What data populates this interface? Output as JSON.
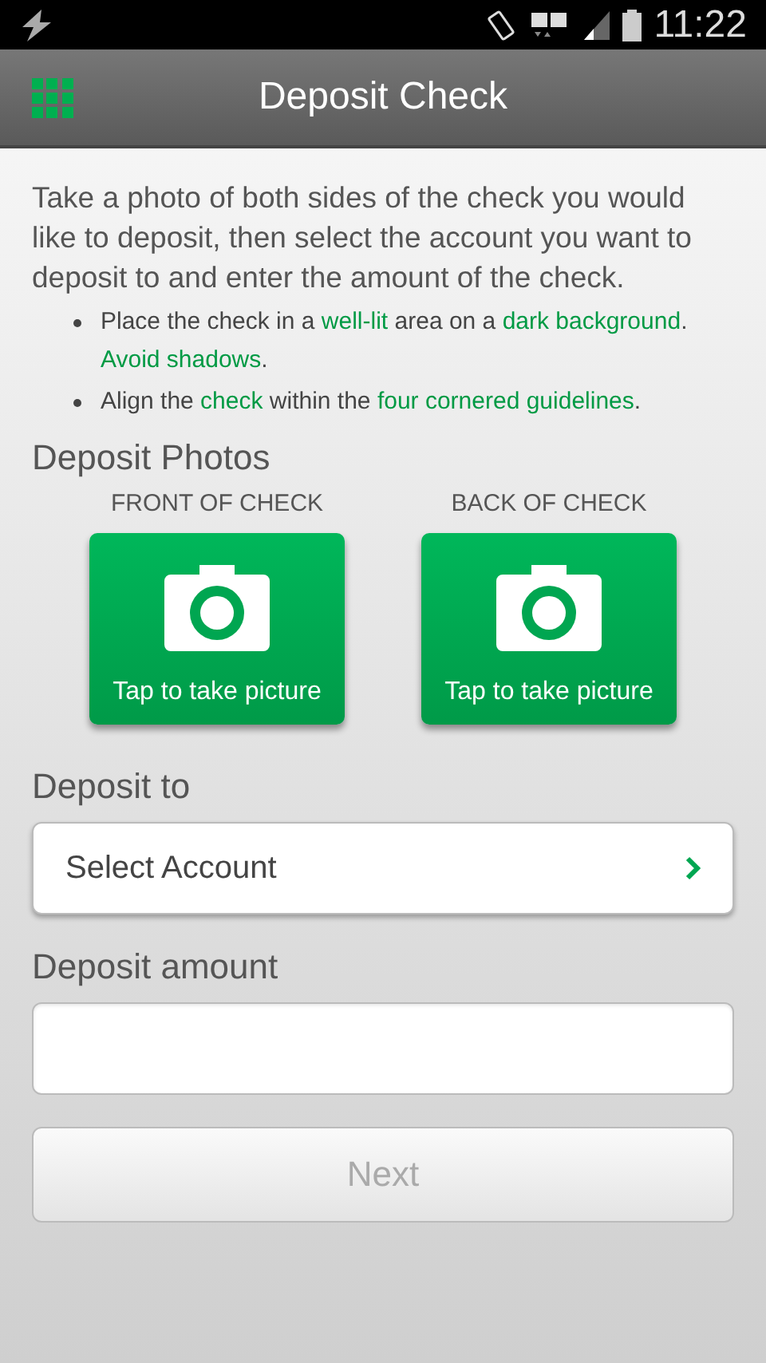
{
  "status_bar": {
    "time": "11:22"
  },
  "app_bar": {
    "title": "Deposit Check"
  },
  "intro": "Take a photo of both sides of the check you would like to deposit, then select the account you want to deposit to and enter the amount of the check.",
  "tips": [
    [
      {
        "text": "Place the check in a ",
        "highlight": false
      },
      {
        "text": "well-lit",
        "highlight": true
      },
      {
        "text": " area on a ",
        "highlight": false
      },
      {
        "text": "dark background",
        "highlight": true
      },
      {
        "text": ". ",
        "highlight": false
      },
      {
        "text": "Avoid shadows",
        "highlight": true
      },
      {
        "text": ".",
        "highlight": false
      }
    ],
    [
      {
        "text": "Align the ",
        "highlight": false
      },
      {
        "text": "check",
        "highlight": true
      },
      {
        "text": " within the ",
        "highlight": false
      },
      {
        "text": "four cornered guidelines",
        "highlight": true
      },
      {
        "text": ".",
        "highlight": false
      }
    ]
  ],
  "photos": {
    "heading": "Deposit Photos",
    "items": [
      {
        "caption": "FRONT OF CHECK",
        "button": "Tap to take picture"
      },
      {
        "caption": "BACK OF CHECK",
        "button": "Tap to take picture"
      }
    ]
  },
  "deposit_to": {
    "label": "Deposit to",
    "value": "Select Account"
  },
  "deposit_amount": {
    "label": "Deposit amount"
  },
  "next_button": {
    "label": "Next",
    "disabled": true
  }
}
